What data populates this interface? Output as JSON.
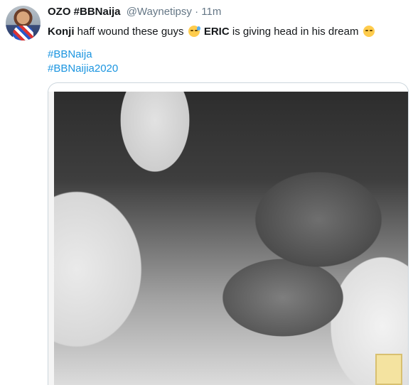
{
  "tweet": {
    "author": {
      "name": "OZO #BBNaija",
      "handle": "@Waynetipsy",
      "separator": "·",
      "time": "11m"
    },
    "text": {
      "part1_bold": "Konji",
      "part1": " haff wound these guys ",
      "part2_bold": "ERIC",
      "part2": " is giving head in his dream "
    },
    "emojis": [
      "grinning-sweat-emoji",
      "smiling-face-emoji"
    ],
    "hashtags": [
      "#BBNaija",
      "#BBNaijia2020"
    ]
  }
}
